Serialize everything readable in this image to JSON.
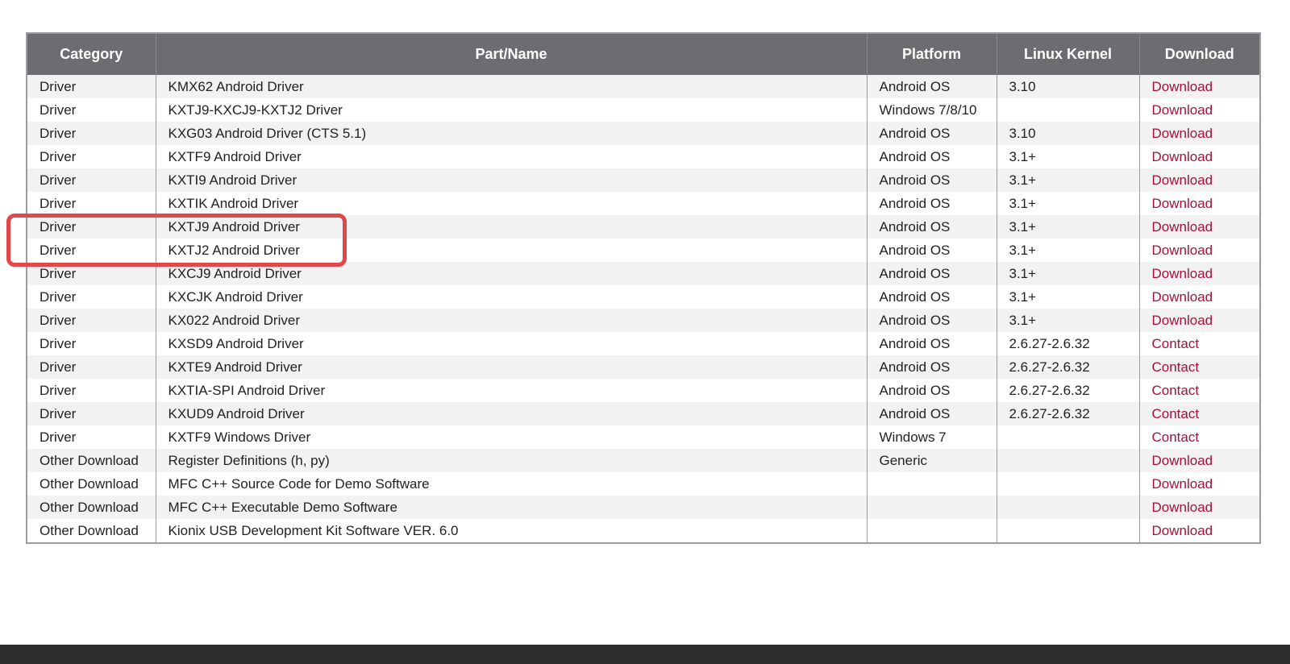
{
  "table": {
    "headers": [
      "Category",
      "Part/Name",
      "Platform",
      "Linux Kernel",
      "Download"
    ],
    "rows": [
      {
        "category": "Driver",
        "part": "KMX62 Android Driver",
        "platform": "Android OS",
        "kernel": "3.10",
        "download": "Download"
      },
      {
        "category": "Driver",
        "part": "KXTJ9-KXCJ9-KXTJ2 Driver",
        "platform": "Windows 7/8/10",
        "kernel": "",
        "download": "Download"
      },
      {
        "category": "Driver",
        "part": "KXG03 Android Driver (CTS 5.1)",
        "platform": "Android OS",
        "kernel": "3.10",
        "download": "Download"
      },
      {
        "category": "Driver",
        "part": "KXTF9 Android Driver",
        "platform": "Android OS",
        "kernel": "3.1+",
        "download": "Download"
      },
      {
        "category": "Driver",
        "part": "KXTI9 Android Driver",
        "platform": "Android OS",
        "kernel": "3.1+",
        "download": "Download"
      },
      {
        "category": "Driver",
        "part": "KXTIK Android Driver",
        "platform": "Android OS",
        "kernel": "3.1+",
        "download": "Download"
      },
      {
        "category": "Driver",
        "part": "KXTJ9 Android Driver",
        "platform": "Android OS",
        "kernel": "3.1+",
        "download": "Download"
      },
      {
        "category": "Driver",
        "part": "KXTJ2 Android Driver",
        "platform": "Android OS",
        "kernel": "3.1+",
        "download": "Download"
      },
      {
        "category": "Driver",
        "part": "KXCJ9 Android Driver",
        "platform": "Android OS",
        "kernel": "3.1+",
        "download": "Download"
      },
      {
        "category": "Driver",
        "part": "KXCJK Android Driver",
        "platform": "Android OS",
        "kernel": "3.1+",
        "download": "Download"
      },
      {
        "category": "Driver",
        "part": "KX022 Android Driver",
        "platform": "Android OS",
        "kernel": "3.1+",
        "download": "Download"
      },
      {
        "category": "Driver",
        "part": "KXSD9 Android Driver",
        "platform": "Android OS",
        "kernel": "2.6.27-2.6.32",
        "download": "Contact"
      },
      {
        "category": "Driver",
        "part": "KXTE9 Android Driver",
        "platform": "Android OS",
        "kernel": "2.6.27-2.6.32",
        "download": "Contact"
      },
      {
        "category": "Driver",
        "part": "KXTIA-SPI Android Driver",
        "platform": "Android OS",
        "kernel": "2.6.27-2.6.32",
        "download": "Contact"
      },
      {
        "category": "Driver",
        "part": "KXUD9 Android Driver",
        "platform": "Android OS",
        "kernel": "2.6.27-2.6.32",
        "download": "Contact"
      },
      {
        "category": "Driver",
        "part": "KXTF9 Windows Driver",
        "platform": "Windows 7",
        "kernel": "",
        "download": "Contact"
      },
      {
        "category": "Other Download",
        "part": "Register Definitions (h, py)",
        "platform": "Generic",
        "kernel": "",
        "download": "Download"
      },
      {
        "category": "Other Download",
        "part": "MFC C++ Source Code for Demo Software",
        "platform": "",
        "kernel": "",
        "download": "Download"
      },
      {
        "category": "Other Download",
        "part": "MFC C++ Executable Demo Software",
        "platform": "",
        "kernel": "",
        "download": "Download"
      },
      {
        "category": "Other Download",
        "part": "Kionix USB Development Kit Software VER. 6.0",
        "platform": "",
        "kernel": "",
        "download": "Download"
      }
    ]
  },
  "colors": {
    "header_bg": "#6d6c70",
    "link": "#a3123b",
    "highlight": "#e2474a",
    "row_alt": "#f2f2f2"
  }
}
